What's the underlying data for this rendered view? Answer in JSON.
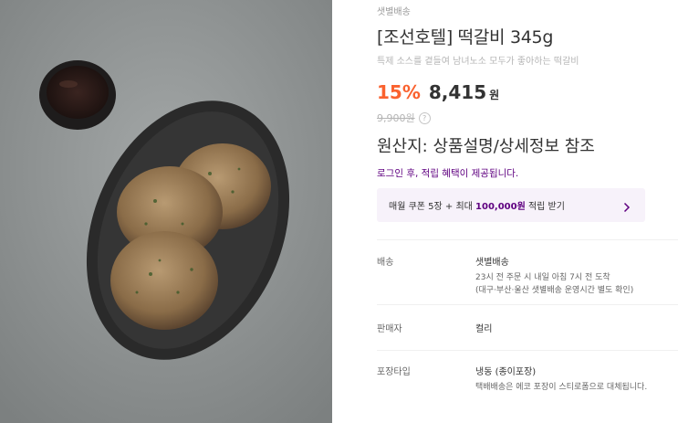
{
  "delivery_type": "샛별배송",
  "title": "[조선호텔] 떡갈비 345g",
  "subtitle": "특제 소스를 곁들여 남녀노소 모두가 좋아하는 떡갈비",
  "price": {
    "discount": "15%",
    "amount": "8,415",
    "unit": "원",
    "original": "9,900원",
    "help_icon": "?"
  },
  "origin": "원산지: 상품설명/상세정보 참조",
  "login_note": "로그인 후, 적립 혜택이 제공됩니다.",
  "coupon": {
    "prefix": "매월 쿠폰 5장 + 최대 ",
    "highlight": "100,000원",
    "suffix": " 적립 받기"
  },
  "details": {
    "delivery": {
      "label": "배송",
      "value": "샛별배송",
      "line1": "23시 전 주문 시 내일 아침 7시 전 도착",
      "line2": "(대구·부산·울산 샛별배송 운영시간 별도 확인)"
    },
    "seller": {
      "label": "판매자",
      "value": "컬리"
    },
    "packaging": {
      "label": "포장타입",
      "value": "냉동 (종이포장)",
      "line1": "택배배송은 에코 포장이 스티로폼으로 대체됩니다."
    }
  },
  "colors": {
    "discount": "#fa622f",
    "accent_purple": "#5f0080",
    "coupon_bg": "#f7f2fa"
  }
}
